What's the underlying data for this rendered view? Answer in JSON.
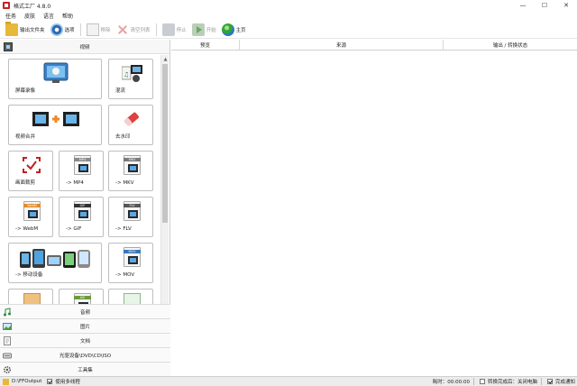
{
  "window": {
    "title": "格式工厂 4.8.0",
    "controls": {
      "minimize": "—",
      "maximize": "☐",
      "close": "✕"
    }
  },
  "menu": [
    "任务",
    "皮肤",
    "语言",
    "帮助"
  ],
  "toolbar": {
    "output_folder": "输出文件夹",
    "options": "选项",
    "remove": "移除",
    "clear_list": "清空列表",
    "stop": "停止",
    "start": "开始",
    "home": "主页"
  },
  "left_panel": {
    "video_category": "视频",
    "tiles": [
      {
        "label": "屏幕录像",
        "icon": "screen-record-icon"
      },
      {
        "label": "混流",
        "icon": "mux-icon"
      },
      {
        "label": "视频合并",
        "icon": "video-merge-icon"
      },
      {
        "label": "去水印",
        "icon": "remove-watermark-icon"
      },
      {
        "label": "画面裁剪",
        "icon": "crop-icon"
      },
      {
        "label": "-> MP4",
        "icon": "mp4-file-icon",
        "band": "MP4"
      },
      {
        "label": "-> MKV",
        "icon": "mkv-file-icon",
        "band": "MKV"
      },
      {
        "label": "-> WebM",
        "icon": "webm-file-icon",
        "band": "WebM"
      },
      {
        "label": "-> GIF",
        "icon": "gif-file-icon",
        "band": "GIF"
      },
      {
        "label": "-> FLV",
        "icon": "flv-file-icon",
        "band": "FLV"
      },
      {
        "label": "-> 移动设备",
        "icon": "mobile-devices-icon"
      },
      {
        "label": "-> MOV",
        "icon": "mov-file-icon",
        "band": "MOV"
      },
      {
        "label": "",
        "icon": "partial-tile-icon"
      },
      {
        "label": "",
        "icon": "avi-file-icon",
        "band": "AVI"
      },
      {
        "label": "",
        "icon": "partial-tile-icon"
      }
    ],
    "categories": [
      {
        "label": "音频",
        "icon": "audio-note-icon"
      },
      {
        "label": "图片",
        "icon": "picture-icon"
      },
      {
        "label": "文档",
        "icon": "document-icon"
      },
      {
        "label": "光驱设备\\DVD\\CD\\ISO",
        "icon": "disc-icon"
      },
      {
        "label": "工具集",
        "icon": "tools-icon"
      }
    ]
  },
  "task_table": {
    "columns": [
      "预览",
      "来源",
      "输出 / 转换状态"
    ]
  },
  "statusbar": {
    "output_path": "D:\\FFOutput",
    "multithread_label": "使用多线程",
    "multithread_checked": true,
    "elapsed": "耗时：00:00:00",
    "after_convert_label": "转换完成后：关闭电脑",
    "after_convert_checked": false,
    "notify_label": "完成通知",
    "notify_checked": true
  },
  "colors": {
    "brand_red": "#c8202a",
    "folder_yellow": "#e8b838",
    "selection_blue": "#6ab4e8"
  }
}
